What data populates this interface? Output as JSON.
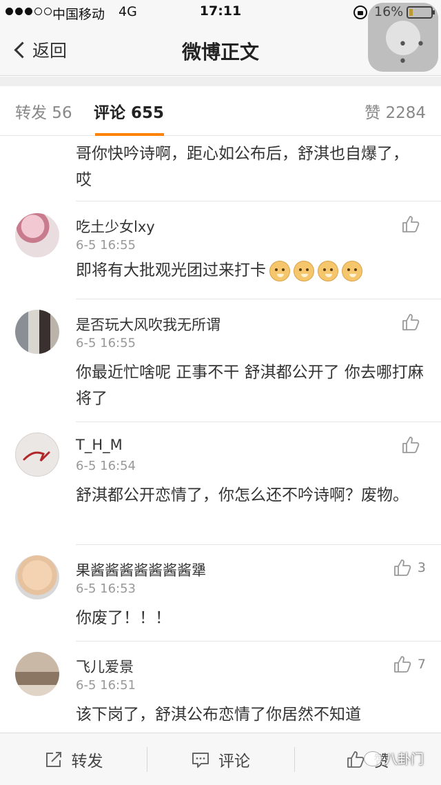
{
  "status_bar": {
    "carrier": "中国移动",
    "network": "4G",
    "time": "17:11",
    "battery": "16%"
  },
  "nav": {
    "back_label": "返回",
    "title": "微博正文",
    "more_label": "• • •"
  },
  "tabs": {
    "reposts": "转发 56",
    "comments": "评论 655",
    "likes": "赞 2284"
  },
  "partial_comment_text": "哥你快吟诗啊，距心如公布后，舒淇也自爆了，哎",
  "comments": [
    {
      "user": "吃土少女lxy",
      "time": "6-5 16:55",
      "text": "即将有大批观光团过来打卡",
      "likes": "",
      "emoji_count": 4
    },
    {
      "user": "是否玩大风吹我无所谓",
      "time": "6-5 16:55",
      "text": "你最近忙啥呢 正事不干 舒淇都公开了 你去哪打麻将了",
      "likes": ""
    },
    {
      "user": "T_H_M",
      "time": "6-5 16:54",
      "text": "舒淇都公开恋情了，你怎么还不吟诗啊？废物。",
      "likes": ""
    },
    {
      "user": "果酱酱酱酱酱酱酱犟",
      "time": "6-5 16:53",
      "text": "你废了！！！",
      "likes": "3"
    },
    {
      "user": "飞儿爱景",
      "time": "6-5 16:51",
      "text": "该下岗了，舒淇公布恋情了你居然不知道",
      "likes": "7"
    }
  ],
  "toolbar": {
    "repost": "转发",
    "comment": "评论",
    "like": "赞"
  },
  "watermark": "八卦门",
  "colors": {
    "accent": "#ff8200",
    "background": "#ffffff",
    "bar": "#f7f7f7"
  }
}
